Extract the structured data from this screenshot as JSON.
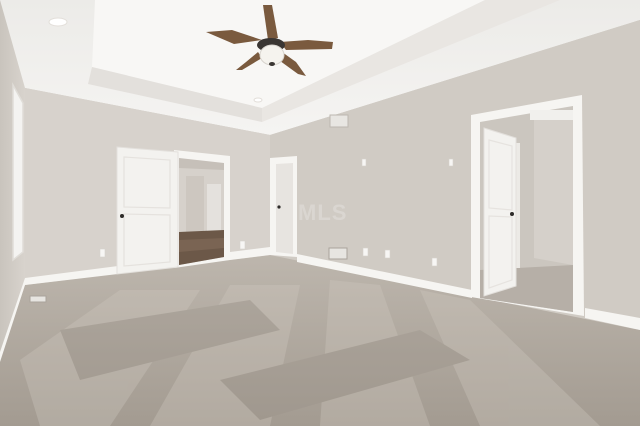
{
  "photo": {
    "watermark_text": "MLS",
    "colors": {
      "wall": "#d6d1cb",
      "wall_right": "#cec9c2",
      "ceiling": "#f1efec",
      "tray_ceiling": "#f7f6f4",
      "trim": "#f6f5f2",
      "door": "#f3f2ef",
      "carpet": "#a9a198",
      "hardwood": "#6c5848",
      "fan_blade": "#7a5a3e",
      "fan_body": "#3a3633"
    }
  }
}
